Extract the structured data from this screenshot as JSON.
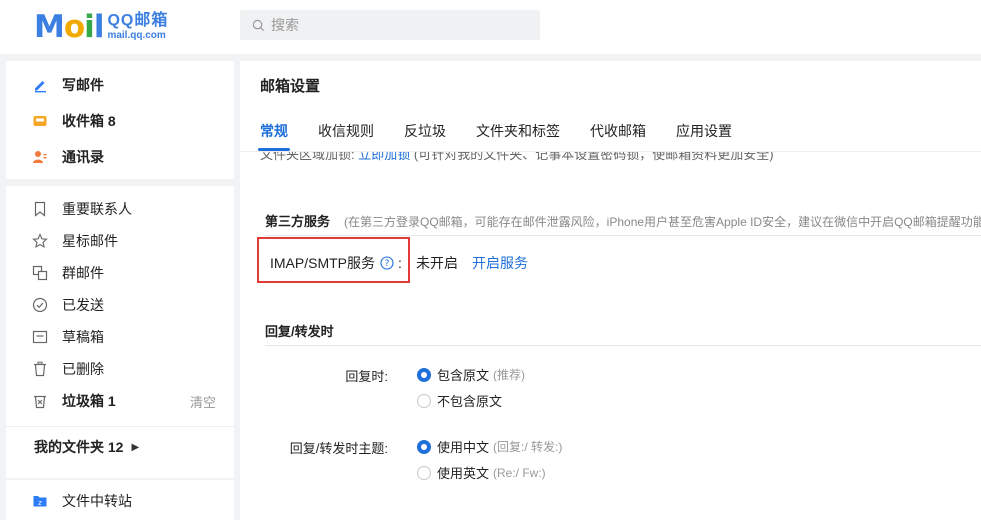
{
  "app": {
    "logo_mail": "M",
    "logo_o": "o",
    "logo_i": "i",
    "logo_l": "l",
    "logo_brand": "QQ邮箱",
    "logo_domain": "mail.qq.com",
    "colors": {
      "accent": "#1e6fd9",
      "highlight_border": "#e53935"
    }
  },
  "search": {
    "placeholder": "搜索",
    "icon": "search-icon"
  },
  "sidebar": {
    "primary": [
      {
        "label": "写邮件",
        "icon": "pen-icon"
      },
      {
        "label": "收件箱 8",
        "icon": "inbox-icon"
      },
      {
        "label": "通讯录",
        "icon": "contacts-icon"
      }
    ],
    "secondary": [
      {
        "label": "重要联系人",
        "icon": "bookmark-icon"
      },
      {
        "label": "星标邮件",
        "icon": "star-icon"
      },
      {
        "label": "群邮件",
        "icon": "group-mail-icon"
      },
      {
        "label": "已发送",
        "icon": "check-circle-icon"
      },
      {
        "label": "草稿箱",
        "icon": "draft-icon"
      },
      {
        "label": "已删除",
        "icon": "trash-icon"
      },
      {
        "label": "垃圾箱 1",
        "icon": "spam-icon",
        "action": "清空"
      }
    ],
    "folders_label": "我的文件夹 12",
    "transfer_label": "文件中转站"
  },
  "main": {
    "title": "邮箱设置",
    "tabs": [
      "常规",
      "收信规则",
      "反垃圾",
      "文件夹和标签",
      "代收邮箱",
      "应用设置"
    ],
    "active_tab": 0,
    "clipped_prefix": "文件夹区域加锁:",
    "clipped_link": "立即加锁",
    "clipped_suffix": "(可针对我的文件夹、记事本设置密码锁，使邮箱资料更加安全)",
    "third_party": {
      "title": "第三方服务",
      "hint": "(在第三方登录QQ邮箱，可能存在邮件泄露风险，iPhone用户甚至危害Apple ID安全，建议在微信中开启QQ邮箱提醒功能",
      "service_label": "IMAP/SMTP服务",
      "colon": ":",
      "status": "未开启",
      "action": "开启服务"
    },
    "reply": {
      "title": "回复/转发时",
      "reply_label": "回复时:",
      "reply_options": [
        {
          "text": "包含原文",
          "note": "(推荐)",
          "selected": true
        },
        {
          "text": "不包含原文",
          "note": "",
          "selected": false
        }
      ],
      "subject_label": "回复/转发时主题:",
      "subject_options": [
        {
          "text": "使用中文",
          "note": "(回复:/ 转发:)",
          "selected": true
        },
        {
          "text": "使用英文",
          "note": "(Re:/ Fw:)",
          "selected": false
        }
      ]
    }
  }
}
